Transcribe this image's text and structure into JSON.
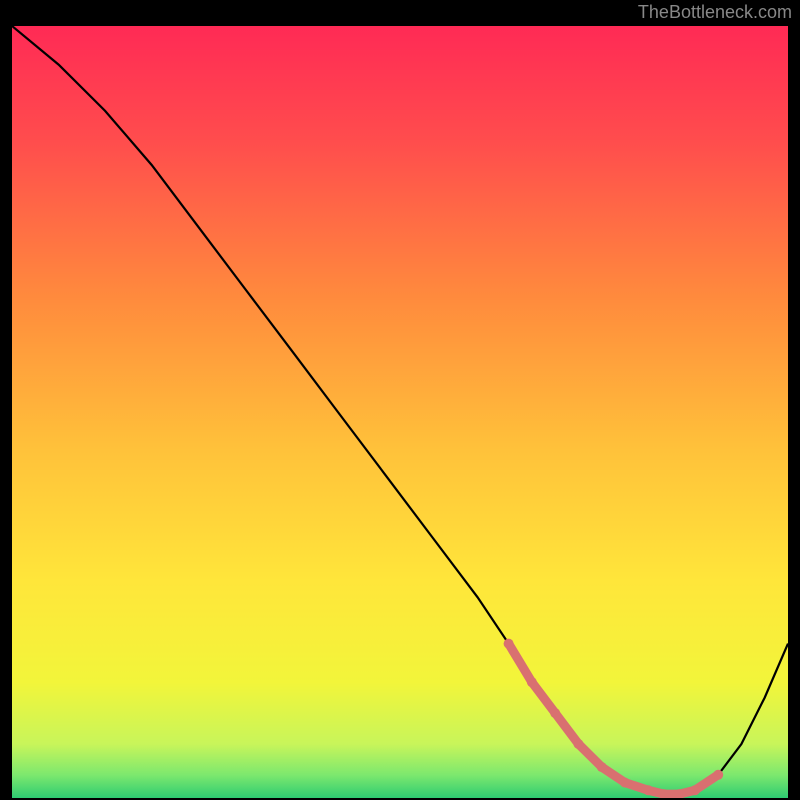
{
  "attribution": "TheBottleneck.com",
  "chart_data": {
    "type": "line",
    "title": "",
    "xlabel": "",
    "ylabel": "",
    "xlim": [
      0,
      100
    ],
    "ylim": [
      0,
      100
    ],
    "series": [
      {
        "name": "bottleneck-curve",
        "x": [
          0,
          6,
          12,
          18,
          24,
          30,
          36,
          42,
          48,
          54,
          60,
          64,
          67,
          70,
          73,
          76,
          79,
          82,
          84,
          86,
          88,
          91,
          94,
          97,
          100
        ],
        "values": [
          100,
          95,
          89,
          82,
          74,
          66,
          58,
          50,
          42,
          34,
          26,
          20,
          15,
          11,
          7,
          4,
          2,
          1,
          0.5,
          0.5,
          1,
          3,
          7,
          13,
          20
        ]
      }
    ],
    "markers": {
      "name": "highlighted-range",
      "color": "#d97070",
      "x": [
        64,
        67,
        70,
        73,
        76,
        79,
        82,
        84,
        86,
        88,
        91
      ],
      "values": [
        20,
        15,
        11,
        7,
        4,
        2,
        1,
        0.5,
        0.5,
        1,
        3
      ]
    },
    "gradient": {
      "stops": [
        {
          "pos": 0.0,
          "color": "#ff2a55"
        },
        {
          "pos": 0.15,
          "color": "#ff4d4d"
        },
        {
          "pos": 0.35,
          "color": "#ff8a3d"
        },
        {
          "pos": 0.55,
          "color": "#ffc23a"
        },
        {
          "pos": 0.72,
          "color": "#ffe63a"
        },
        {
          "pos": 0.85,
          "color": "#f2f53a"
        },
        {
          "pos": 0.93,
          "color": "#c8f55a"
        },
        {
          "pos": 0.97,
          "color": "#7de86e"
        },
        {
          "pos": 1.0,
          "color": "#2ecc71"
        }
      ]
    }
  }
}
